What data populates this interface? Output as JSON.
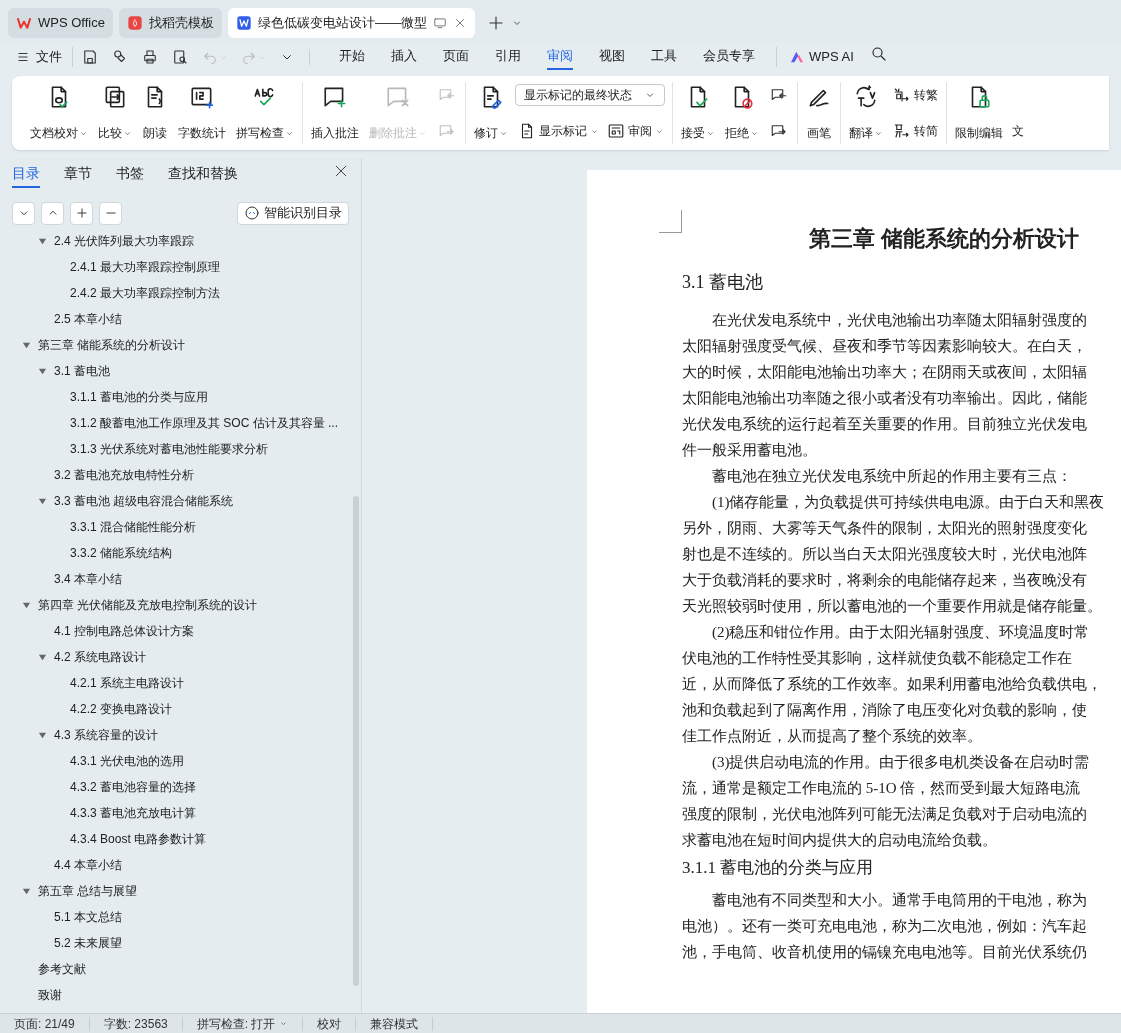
{
  "title_tabs": [
    {
      "label": "WPS Office",
      "kind": "home",
      "selected": false
    },
    {
      "label": "找稻壳模板",
      "kind": "template",
      "selected": false
    },
    {
      "label": "绿色低碳变电站设计——微型",
      "kind": "doc",
      "selected": true
    }
  ],
  "menu": {
    "file": "文件",
    "tabs": [
      {
        "label": "开始",
        "selected": false
      },
      {
        "label": "插入",
        "selected": false
      },
      {
        "label": "页面",
        "selected": false
      },
      {
        "label": "引用",
        "selected": false
      },
      {
        "label": "审阅",
        "selected": true
      },
      {
        "label": "视图",
        "selected": false
      },
      {
        "label": "工具",
        "selected": false
      },
      {
        "label": "会员专享",
        "selected": false
      }
    ],
    "ai": "WPS AI"
  },
  "ribbon": [
    {
      "items": [
        {
          "kind": "large",
          "label": "文档校对",
          "dropdown": true,
          "disabled": false
        },
        {
          "kind": "large",
          "label": "比较",
          "dropdown": true,
          "disabled": false
        },
        {
          "kind": "large",
          "label": "朗读",
          "dropdown": false,
          "disabled": false
        },
        {
          "kind": "large",
          "label": "字数统计",
          "dropdown": false,
          "disabled": false
        },
        {
          "kind": "large",
          "label": "拼写检查",
          "dropdown": true,
          "disabled": false
        }
      ]
    },
    {
      "items": [
        {
          "kind": "large",
          "label": "插入批注",
          "dropdown": false,
          "disabled": false
        },
        {
          "kind": "large",
          "label": "删除批注",
          "dropdown": true,
          "disabled": true
        },
        {
          "kind": "column",
          "items": [
            {
              "kind": "iconbtn",
              "disabled": true
            },
            {
              "kind": "iconbtn",
              "disabled": true
            }
          ]
        }
      ]
    },
    {
      "items": [
        {
          "kind": "large",
          "label": "修订",
          "dropdown": true,
          "disabled": false
        },
        {
          "kind": "column",
          "items": [
            {
              "kind": "select",
              "value": "显示标记的最终状态"
            },
            {
              "kind": "row",
              "items": [
                {
                  "kind": "small",
                  "label": "显示标记",
                  "dropdown": true,
                  "disabled": false
                },
                {
                  "kind": "small",
                  "label": "审阅",
                  "dropdown": true,
                  "disabled": false
                }
              ]
            }
          ]
        }
      ]
    },
    {
      "items": [
        {
          "kind": "large",
          "label": "接受",
          "dropdown": true,
          "disabled": false
        },
        {
          "kind": "large",
          "label": "拒绝",
          "dropdown": true,
          "disabled": false
        },
        {
          "kind": "column",
          "items": [
            {
              "kind": "iconbtn",
              "disabled": false
            },
            {
              "kind": "iconbtn",
              "disabled": false
            }
          ]
        }
      ]
    },
    {
      "items": [
        {
          "kind": "large",
          "label": "画笔",
          "dropdown": false,
          "disabled": false
        }
      ]
    },
    {
      "items": [
        {
          "kind": "large",
          "label": "翻译",
          "dropdown": true,
          "disabled": false
        },
        {
          "kind": "column",
          "items": [
            {
              "kind": "small",
              "label": "转繁",
              "dropdown": false,
              "disabled": false
            },
            {
              "kind": "small",
              "label": "转简",
              "dropdown": false,
              "disabled": false
            }
          ]
        }
      ]
    },
    {
      "items": [
        {
          "kind": "large",
          "label": "限制编辑",
          "dropdown": false,
          "disabled": false
        },
        {
          "kind": "text",
          "label": "文"
        }
      ]
    }
  ],
  "sidebar": {
    "tabs": [
      {
        "label": "目录",
        "selected": true
      },
      {
        "label": "章节",
        "selected": false
      },
      {
        "label": "书签",
        "selected": false
      },
      {
        "label": "查找和替换",
        "selected": false
      }
    ],
    "smart_button": "智能识别目录",
    "continued_items": [
      {
        "label": "2.4 光伏阵列最大功率跟踪",
        "expanded": true,
        "children": [
          {
            "label": "2.4.1 最大功率跟踪控制原理"
          },
          {
            "label": "2.4.2  最大功率跟踪控制方法"
          }
        ]
      },
      {
        "label": "2.5  本章小结"
      }
    ],
    "items": [
      {
        "label": "第三章  储能系统的分析设计",
        "expanded": true,
        "children": [
          {
            "label": "3.1  蓄电池",
            "expanded": true,
            "children": [
              {
                "label": "3.1.1 蓄电池的分类与应用"
              },
              {
                "label": "3.1.2 酸蓄电池工作原理及其  SOC  估计及其容量 ..."
              },
              {
                "label": "3.1.3  光伏系统对蓄电池性能要求分析"
              }
            ]
          },
          {
            "label": "3.2 蓄电池充放电特性分析"
          },
          {
            "label": "3.3  蓄电池  超级电容混合储能系统",
            "expanded": true,
            "children": [
              {
                "label": "3.3.1  混合储能性能分析"
              },
              {
                "label": "3.3.2  储能系统结构"
              }
            ]
          },
          {
            "label": "3.4 本章小结"
          }
        ]
      },
      {
        "label": "第四章  光伏储能及充放电控制系统的设计",
        "expanded": true,
        "children": [
          {
            "label": "4.1 控制电路总体设计方案"
          },
          {
            "label": "4.2 系统电路设计",
            "expanded": true,
            "children": [
              {
                "label": "4.2.1 系统主电路设计"
              },
              {
                "label": "4.2.2  变换电路设计"
              }
            ]
          },
          {
            "label": "4.3 系统容量的设计",
            "expanded": true,
            "children": [
              {
                "label": "4.3.1 光伏电池的选用"
              },
              {
                "label": "4.3.2 蓄电池容量的选择"
              },
              {
                "label": "4.3.3 蓄电池充放电计算"
              },
              {
                "label": "4.3.4 Boost 电路参数计算"
              }
            ]
          },
          {
            "label": "4.4 本章小结"
          }
        ]
      },
      {
        "label": "第五章  总结与展望",
        "expanded": true,
        "children": [
          {
            "label": "5.1  本文总结"
          },
          {
            "label": "5.2 未来展望"
          }
        ]
      },
      {
        "label": "参考文献"
      },
      {
        "label": "致谢"
      }
    ]
  },
  "document": {
    "chapter_title": "第三章  储能系统的分析设计",
    "blocks": [
      {
        "kind": "heading",
        "text": "3.1  蓄电池"
      },
      {
        "kind": "paragraph",
        "lines": [
          "在光伏发电系统中，光伏电池输出功率随太阳辐射强度的",
          "太阳辐射强度受气候、昼夜和季节等因素影响较大。在白天，",
          "大的时候，太阳能电池输出功率大；在阴雨天或夜间，太阳辐",
          "太阳能电池输出功率随之很小或者没有功率输出。因此，储能",
          "光伏发电系统的运行起着至关重要的作用。目前独立光伏发电",
          "件一般采用蓄电池。"
        ]
      },
      {
        "kind": "paragraph",
        "lines": [
          "蓄电池在独立光伏发电系统中所起的作用主要有三点："
        ]
      },
      {
        "kind": "paragraph",
        "lines": [
          "(1)储存能量，为负载提供可持续供电电源。由于白天和黑夜",
          "另外，阴雨、大雾等天气条件的限制，太阳光的照射强度变化",
          "射也是不连续的。所以当白天太阳光强度较大时，光伏电池阵",
          "大于负载消耗的要求时，将剩余的电能储存起来，当夜晚没有",
          "天光照较弱时使用，所以蓄电池的一个重要作用就是储存能量。"
        ]
      },
      {
        "kind": "paragraph",
        "lines": [
          "(2)稳压和钳位作用。由于太阳光辐射强度、环境温度时常",
          "伏电池的工作特性受其影响，这样就使负载不能稳定工作在",
          "近，从而降低了系统的工作效率。如果利用蓄电池给负载供电，",
          "池和负载起到了隔离作用，消除了电压变化对负载的影响，使",
          "佳工作点附近，从而提高了整个系统的效率。"
        ]
      },
      {
        "kind": "paragraph",
        "lines": [
          "(3)提供启动电流的作用。由于很多电机类设备在启动时需",
          "流，通常是额定工作电流的 5-1O 倍，然而受到最大短路电流",
          "强度的限制，光伏电池阵列可能无法满足负载对于启动电流的",
          "求蓄电池在短时间内提供大的启动电流给负载。"
        ]
      },
      {
        "kind": "subheading",
        "text": "3.1.1 蓄电池的分类与应用"
      },
      {
        "kind": "paragraph",
        "lines": [
          "蓄电池有不同类型和大小。通常手电筒用的干电池，称为",
          "电池）。还有一类可充电电池，称为二次电池，例如：汽车起",
          "池，手电筒、收音机使用的镉镍充电电池等。目前光伏系统仍"
        ]
      }
    ]
  },
  "status_bar": [
    {
      "label": "页面: 21/49",
      "dropdown": false
    },
    {
      "label": "字数: 23563",
      "dropdown": false
    },
    {
      "label": "拼写检查: 打开",
      "dropdown": true
    },
    {
      "label": "校对",
      "dropdown": false
    },
    {
      "label": "兼容模式",
      "dropdown": false
    }
  ]
}
